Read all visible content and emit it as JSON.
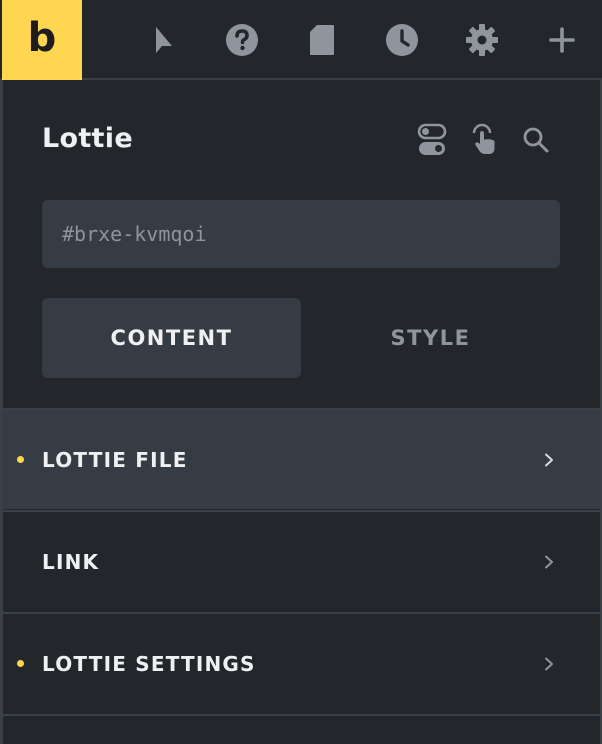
{
  "topbar": {
    "logo_text": "b",
    "icons": [
      "cursor-icon",
      "help-icon",
      "page-icon",
      "history-icon",
      "settings-icon",
      "plus-icon"
    ],
    "accent_color": "#ffd64f"
  },
  "panel": {
    "title": "Lottie",
    "header_icons": [
      "toggle-icon",
      "hand-pointer-icon",
      "search-icon"
    ],
    "id_field": {
      "placeholder": "#brxe-kvmqoi",
      "value": ""
    },
    "tabs": [
      {
        "label": "CONTENT",
        "active": true
      },
      {
        "label": "STYLE",
        "active": false
      }
    ],
    "sections": [
      {
        "label": "LOTTIE FILE",
        "modified": true,
        "active": true
      },
      {
        "label": "LINK",
        "modified": false,
        "active": false
      },
      {
        "label": "LOTTIE SETTINGS",
        "modified": true,
        "active": false
      }
    ]
  }
}
